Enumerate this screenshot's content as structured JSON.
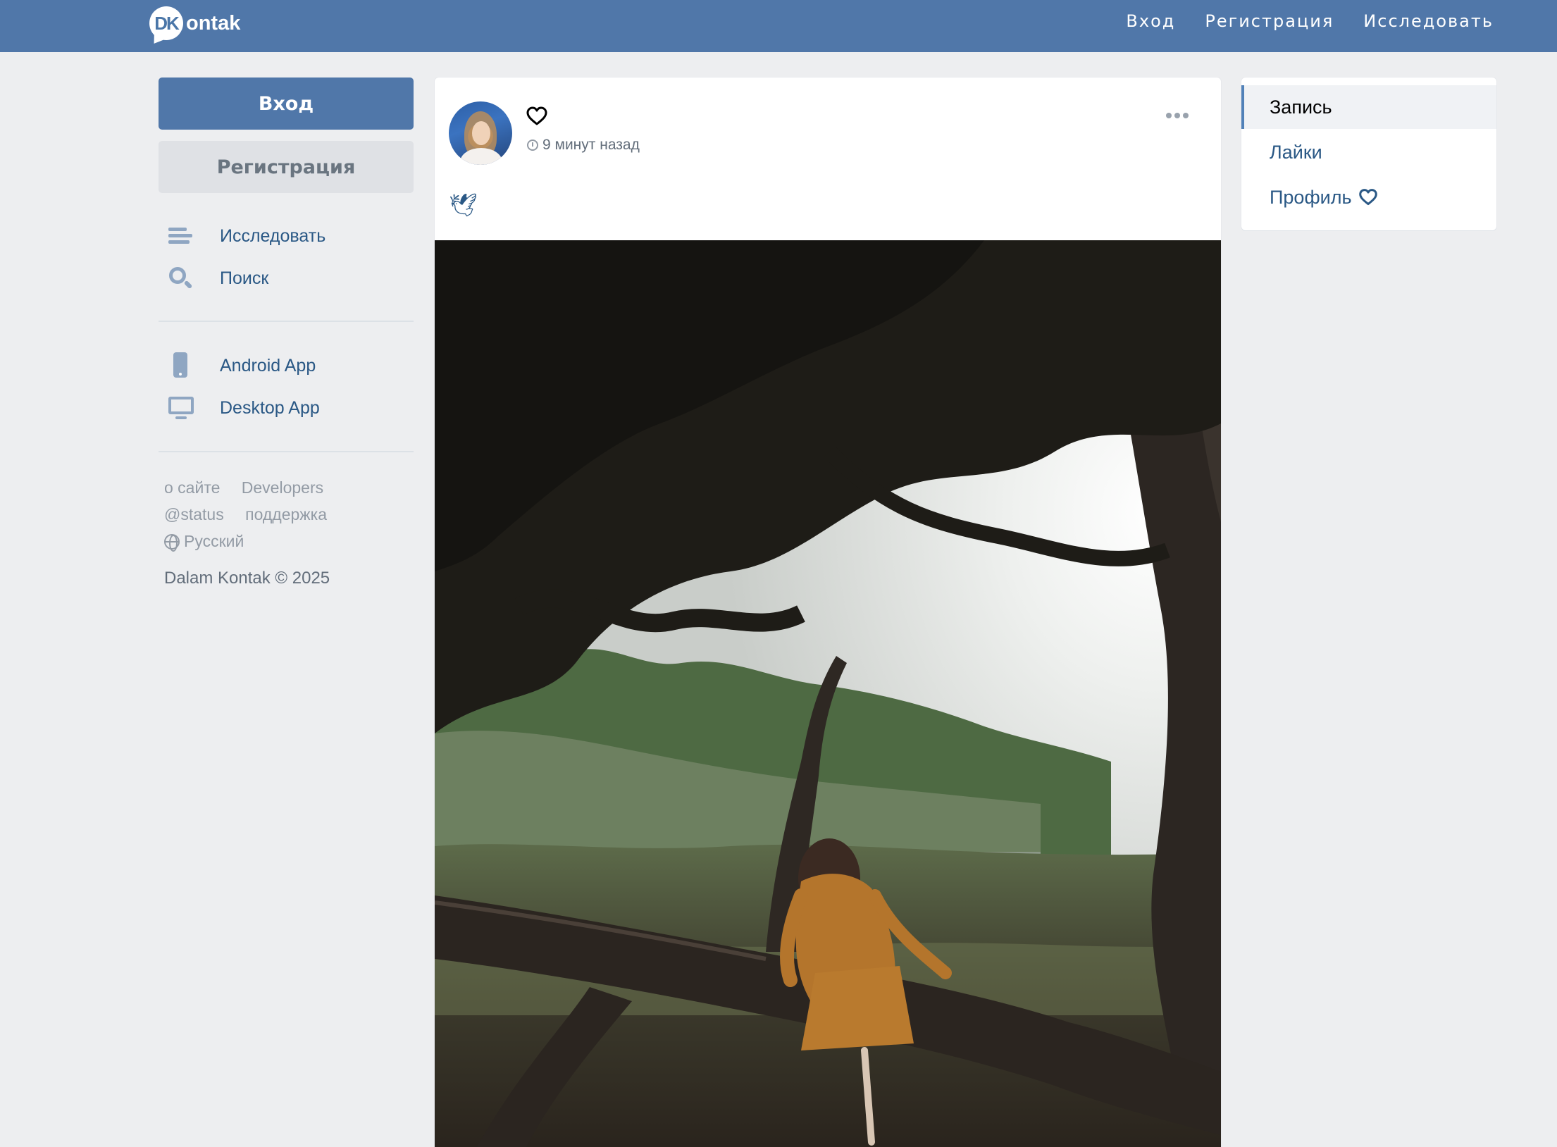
{
  "brand": {
    "badge": "DK",
    "word": "ontak"
  },
  "topnav": {
    "login": "Вход",
    "register": "Регистрация",
    "explore": "Исследовать"
  },
  "sidebar": {
    "login_button": "Вход",
    "register_button": "Регистрация",
    "items": [
      {
        "label": "Исследовать",
        "icon": "explore-icon"
      },
      {
        "label": "Поиск",
        "icon": "search-icon"
      },
      {
        "label": "Android App",
        "icon": "android-phone-icon"
      },
      {
        "label": "Desktop App",
        "icon": "desktop-icon"
      }
    ],
    "footer": {
      "about": "о сайте",
      "developers": "Developers",
      "status": "@status",
      "support": "поддержка",
      "language": "Русский"
    },
    "copyright": "Dalam Kontak © 2025"
  },
  "post": {
    "author_icon": "heart-icon",
    "time": "9 минут назад",
    "text": "🕊"
  },
  "right_menu": {
    "items": [
      {
        "label": "Запись",
        "active": true
      },
      {
        "label": "Лайки",
        "active": false
      },
      {
        "label": "Профиль",
        "active": false,
        "icon": "heart-icon"
      }
    ]
  },
  "colors": {
    "header": "#5077a9",
    "background": "#edeef0",
    "link": "#2a5885",
    "muted": "#939ba5"
  }
}
